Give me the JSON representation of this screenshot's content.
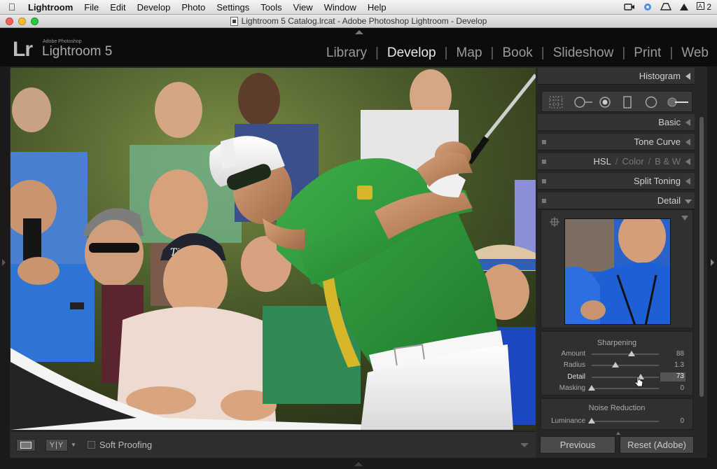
{
  "menubar": {
    "app": "Lightroom",
    "menus": [
      "File",
      "Edit",
      "Develop",
      "Photo",
      "Settings",
      "Tools",
      "View",
      "Window",
      "Help"
    ],
    "tray_text": "2"
  },
  "window": {
    "title": "Lightroom 5 Catalog.lrcat - Adobe Photoshop Lightroom - Develop"
  },
  "lr_header": {
    "logo": "Lr",
    "adobe_line": "Adobe Photoshop",
    "product": "Lightroom 5",
    "modules": [
      "Library",
      "Develop",
      "Map",
      "Book",
      "Slideshow",
      "Print",
      "Web"
    ],
    "active_module": "Develop"
  },
  "right_panel": {
    "histogram": "Histogram",
    "basic": "Basic",
    "tone_curve": "Tone Curve",
    "hsl": {
      "h": "HSL",
      "c": "Color",
      "bw": "B & W"
    },
    "split_toning": "Split Toning",
    "detail": "Detail",
    "sharpening": {
      "title": "Sharpening",
      "rows": [
        {
          "label": "Amount",
          "value": "88",
          "pos": 0.59
        },
        {
          "label": "Radius",
          "value": "1.3",
          "pos": 0.35
        },
        {
          "label": "Detail",
          "value": "73",
          "pos": 0.73
        },
        {
          "label": "Masking",
          "value": "0",
          "pos": 0.0
        }
      ]
    },
    "noise": {
      "title": "Noise Reduction",
      "rows": [
        {
          "label": "Luminance",
          "value": "0",
          "pos": 0.0
        }
      ]
    }
  },
  "toolbar": {
    "yy_label": "Y|Y",
    "soft_proofing": "Soft Proofing"
  },
  "buttons": {
    "previous": "Previous",
    "reset": "Reset (Adobe)"
  },
  "colors": {
    "shirt_green": "#2f9a3e",
    "shirt_yellow": "#d7b72a",
    "crowd_blue": "#2a66c9"
  }
}
